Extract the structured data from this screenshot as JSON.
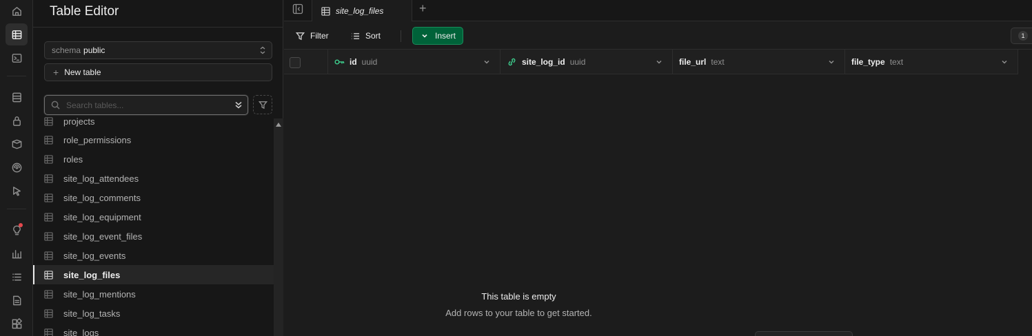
{
  "rail": {
    "icons": [
      "home-icon",
      "table-editor-icon",
      "sql-editor-icon",
      "database-icon",
      "auth-icon",
      "storage-icon",
      "realtime-icon",
      "edge-functions-icon",
      "advisors-icon",
      "reports-icon",
      "logs-icon",
      "api-docs-icon",
      "integrations-icon"
    ]
  },
  "sidebar": {
    "title": "Table Editor",
    "schema_label": "schema",
    "schema_value": "public",
    "new_table_label": "New table",
    "search_placeholder": "Search tables...",
    "tables": [
      "projects",
      "role_permissions",
      "roles",
      "site_log_attendees",
      "site_log_comments",
      "site_log_equipment",
      "site_log_event_files",
      "site_log_events",
      "site_log_files",
      "site_log_mentions",
      "site_log_tasks",
      "site_logs"
    ],
    "active_table": "site_log_files"
  },
  "tabs": {
    "active_tab": "site_log_files"
  },
  "toolbar": {
    "filter_label": "Filter",
    "sort_label": "Sort",
    "insert_label": "Insert",
    "count": "1"
  },
  "columns": [
    {
      "name": "id",
      "type": "uuid",
      "icon": "primary-key-icon"
    },
    {
      "name": "site_log_id",
      "type": "uuid",
      "icon": "foreign-key-link-icon"
    },
    {
      "name": "file_url",
      "type": "text"
    },
    {
      "name": "file_type",
      "type": "text"
    }
  ],
  "empty_state": {
    "title": "This table is empty",
    "subtitle": "Add rows to your table to get started."
  },
  "colors": {
    "accent_green": "#3ecf8e",
    "insert_bg": "#006239",
    "notification": "#e5484d"
  }
}
